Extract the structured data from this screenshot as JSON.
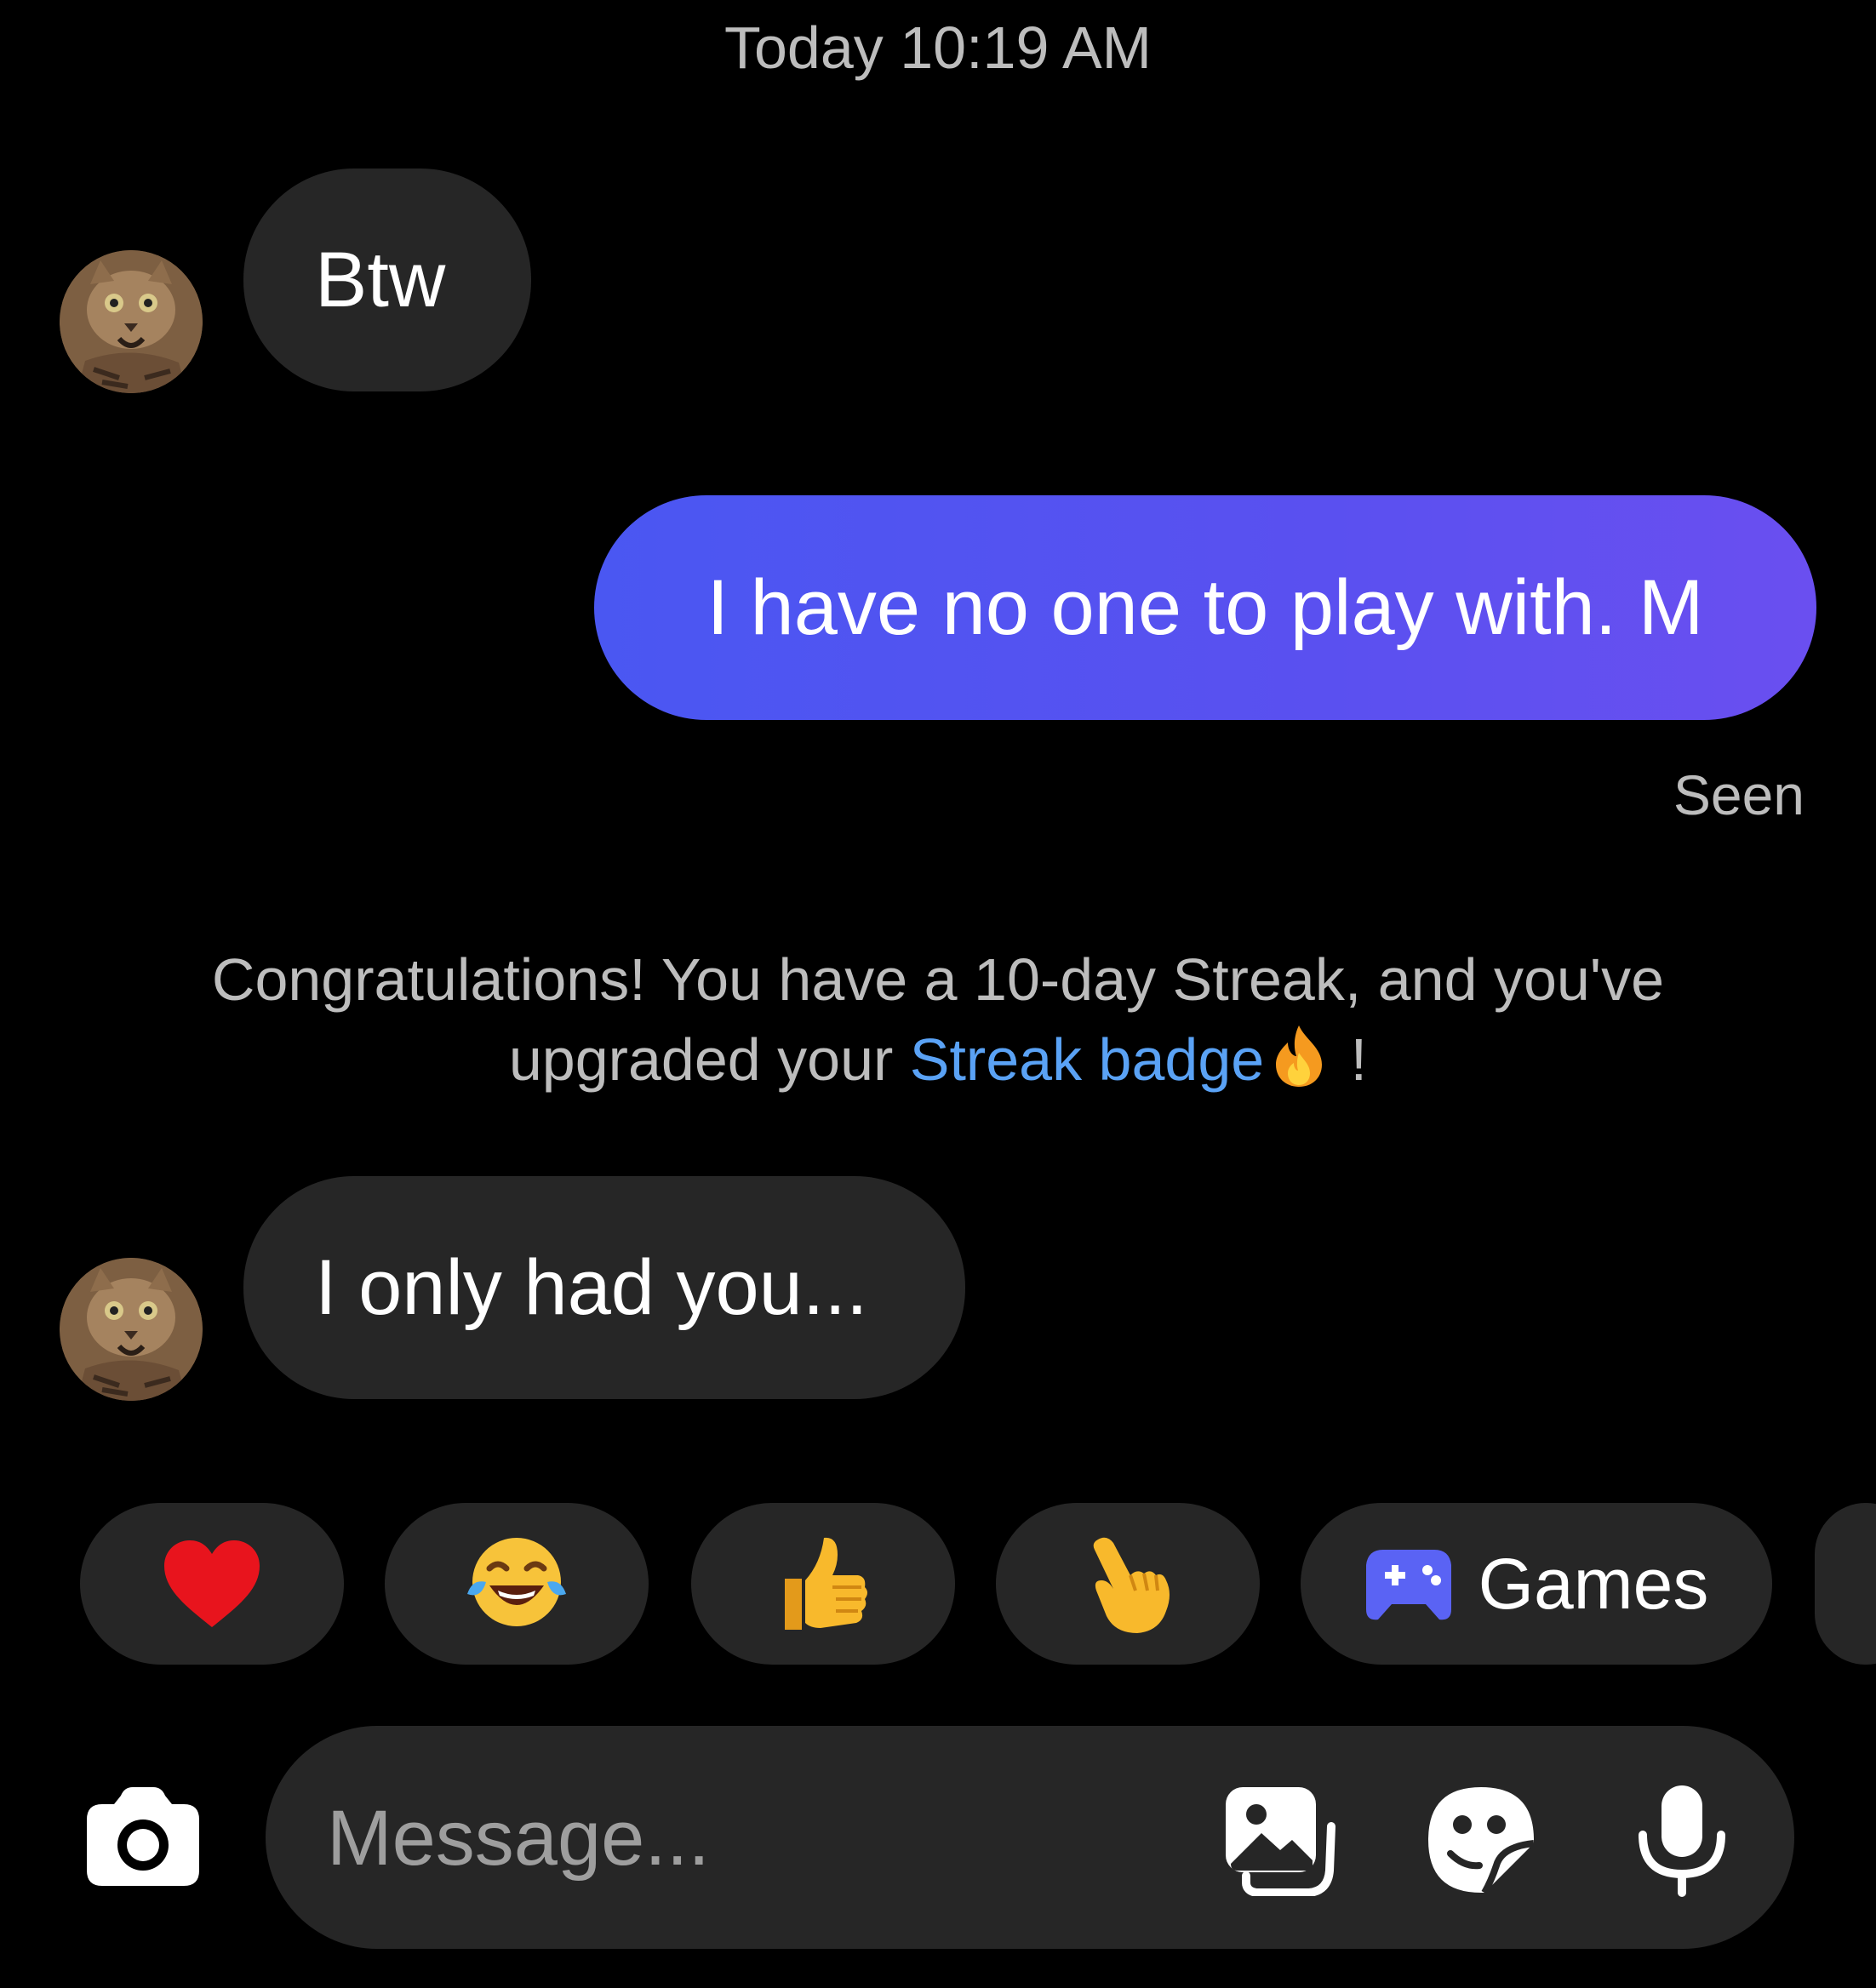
{
  "thread": {
    "timestamp": "Today 10:19 AM",
    "messages": [
      {
        "from": "them",
        "text": "Btw"
      },
      {
        "from": "me",
        "text": "I have no one to play with. M"
      },
      {
        "from": "them",
        "text": "I only had you..."
      }
    ],
    "seen_label": "Seen",
    "streak_notice": {
      "text_before": "Congratulations! You have a 10-day Streak, and you've upgraded your ",
      "link_text": "Streak badge",
      "text_after": " !",
      "icon": "fire-icon"
    }
  },
  "quick_replies": [
    {
      "icon": "red-heart-icon"
    },
    {
      "icon": "tears-of-joy-emoji-icon"
    },
    {
      "icon": "thumbs-up-emoji-icon"
    },
    {
      "icon": "pointing-hand-emoji-icon"
    },
    {
      "icon": "game-controller-icon",
      "label": "Games"
    }
  ],
  "composer": {
    "placeholder": "Message...",
    "icons": [
      "camera-icon",
      "gallery-icon",
      "sticker-icon",
      "microphone-icon"
    ]
  },
  "colors": {
    "background": "#000000",
    "incoming_bubble": "#262626",
    "outgoing_bubble": "#5453f1",
    "link": "#5aa2f5",
    "muted_text": "#bdbdbd"
  }
}
